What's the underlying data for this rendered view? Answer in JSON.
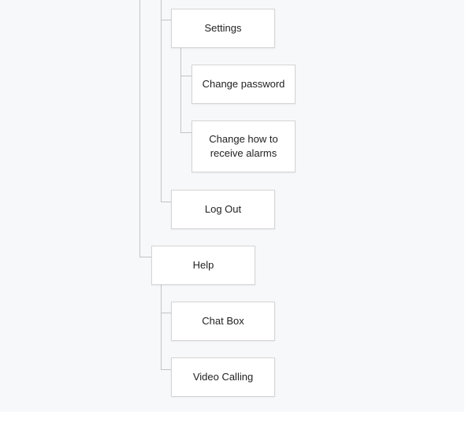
{
  "nodes": {
    "settings": "Settings",
    "change_password": "Change password",
    "change_alarms": "Change how to\nreceive alarms",
    "log_out": "Log Out",
    "help": "Help",
    "chat_box": "Chat Box",
    "video_calling": "Video Calling"
  },
  "colors": {
    "background": "#f7f8fa",
    "node_fill": "#ffffff",
    "node_border": "#d4d4d4",
    "connector": "#c4c4c4",
    "text": "#222222"
  }
}
